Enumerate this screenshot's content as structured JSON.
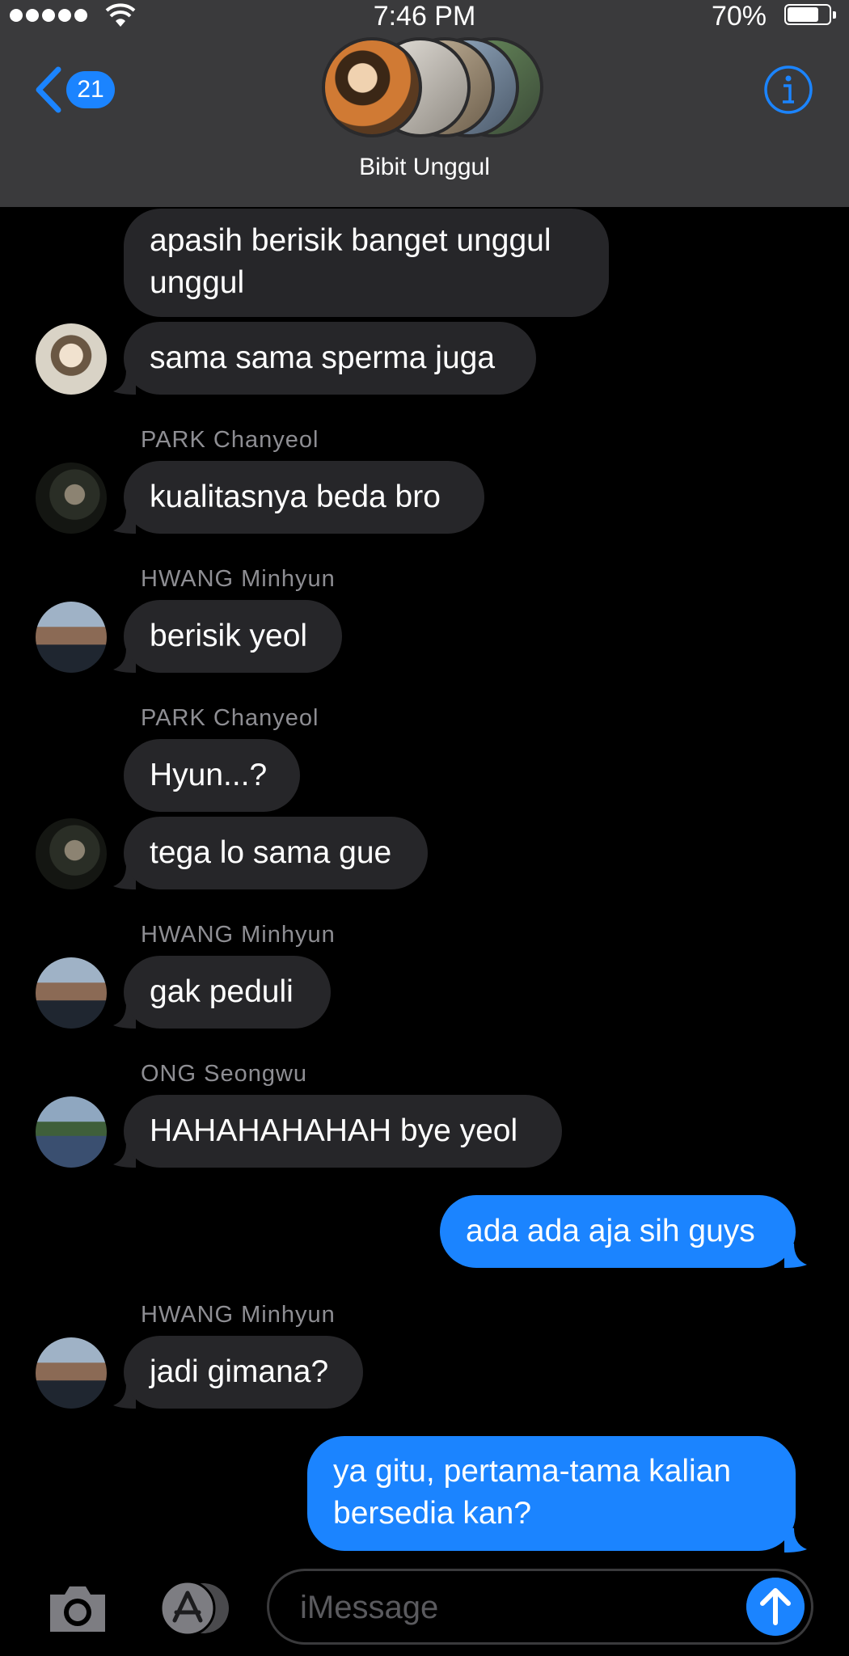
{
  "status": {
    "time": "7:46 PM",
    "battery": "70%"
  },
  "header": {
    "back_count": "21",
    "group_name": "Bibit Unggul"
  },
  "messages": [
    {
      "text": "apasih berisik banget unggul unggul"
    },
    {
      "text": "sama sama sperma juga"
    },
    {
      "sender": "PARK Chanyeol",
      "text": "kualitasnya beda bro"
    },
    {
      "sender": "HWANG Minhyun",
      "text": "berisik yeol"
    },
    {
      "sender": "PARK Chanyeol",
      "text": "Hyun...?"
    },
    {
      "text": "tega lo sama gue"
    },
    {
      "sender": "HWANG Minhyun",
      "text": "gak peduli"
    },
    {
      "sender": "ONG Seongwu",
      "text": "HAHAHAHAHAH bye yeol"
    },
    {
      "text": "ada ada aja sih guys"
    },
    {
      "sender": "HWANG Minhyun",
      "text": "jadi gimana?"
    },
    {
      "text": "ya gitu, pertama-tama kalian bersedia kan?"
    }
  ],
  "compose": {
    "placeholder": "iMessage"
  },
  "colors": {
    "accent": "#1b84ff",
    "incoming_bubble": "#262629",
    "header_bg": "#3a3a3c"
  }
}
